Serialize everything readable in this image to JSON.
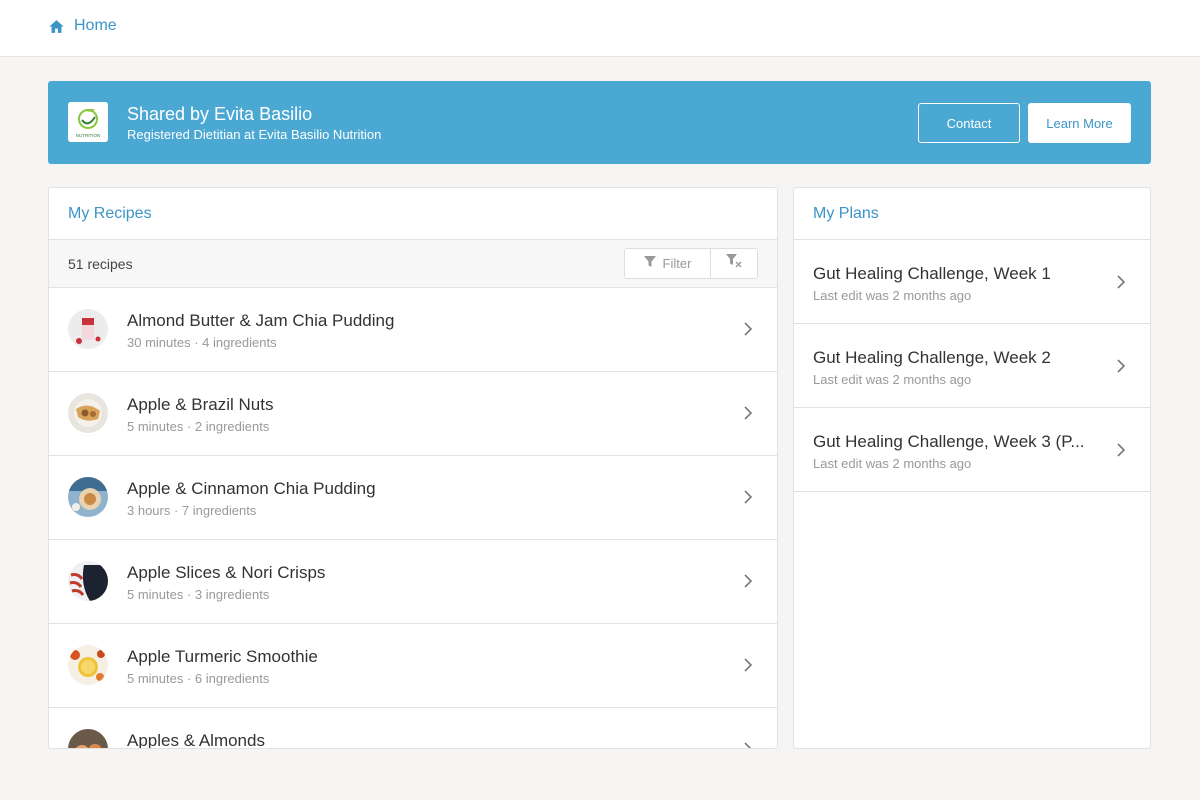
{
  "nav": {
    "home_label": "Home"
  },
  "banner": {
    "title": "Shared by Evita Basilio",
    "subtitle": "Registered Dietitian at Evita Basilio Nutrition",
    "logo_text": "NUTRITION",
    "contact_label": "Contact",
    "learn_more_label": "Learn More"
  },
  "recipes": {
    "title": "My Recipes",
    "count_label": "51 recipes",
    "filter_label": "Filter",
    "items": [
      {
        "name": "Almond Butter & Jam Chia Pudding",
        "meta": "30 minutes · 4 ingredients"
      },
      {
        "name": "Apple & Brazil Nuts",
        "meta": "5 minutes · 2 ingredients"
      },
      {
        "name": "Apple & Cinnamon Chia Pudding",
        "meta": "3 hours · 7 ingredients"
      },
      {
        "name": "Apple Slices & Nori Crisps",
        "meta": "5 minutes · 3 ingredients"
      },
      {
        "name": "Apple Turmeric Smoothie",
        "meta": "5 minutes · 6 ingredients"
      },
      {
        "name": "Apples & Almonds",
        "meta": ""
      }
    ]
  },
  "plans": {
    "title": "My Plans",
    "items": [
      {
        "name": "Gut Healing Challenge, Week 1",
        "meta": "Last edit was 2 months ago"
      },
      {
        "name": "Gut Healing Challenge, Week 2",
        "meta": "Last edit was 2 months ago"
      },
      {
        "name": "Gut Healing Challenge, Week 3 (P...",
        "meta": "Last edit was 2 months ago"
      }
    ]
  },
  "colors": {
    "accent": "#3b95c7",
    "banner_bg": "#4aa8d3",
    "page_bg": "#f6f5f3"
  },
  "icons": [
    "home-icon",
    "filter-icon",
    "clear-filter-icon",
    "chevron-right-icon"
  ]
}
